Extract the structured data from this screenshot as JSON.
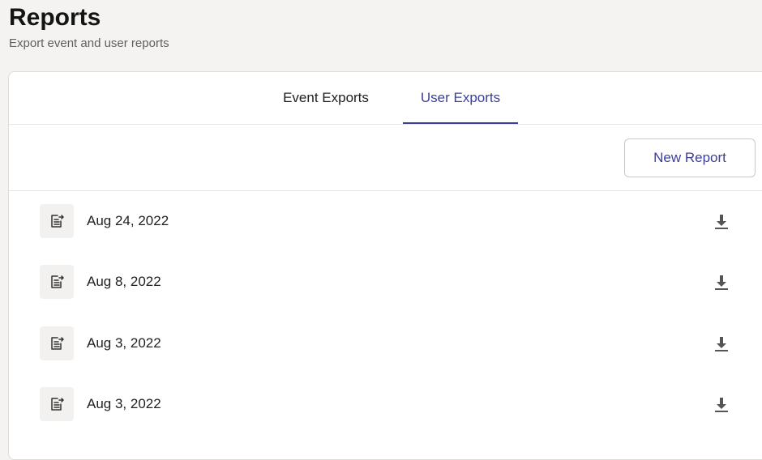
{
  "header": {
    "title": "Reports",
    "subtitle": "Export event and user reports"
  },
  "tabs": [
    {
      "label": "Event Exports",
      "active": false
    },
    {
      "label": "User Exports",
      "active": true
    }
  ],
  "toolbar": {
    "new_report_label": "New Report"
  },
  "reports": [
    {
      "date": "Aug 24, 2022",
      "icon": "file-export-icon",
      "action_icon": "download-icon"
    },
    {
      "date": "Aug 8, 2022",
      "icon": "file-export-icon",
      "action_icon": "download-icon"
    },
    {
      "date": "Aug 3, 2022",
      "icon": "file-export-icon",
      "action_icon": "download-icon"
    },
    {
      "date": "Aug 3, 2022",
      "icon": "file-export-icon",
      "action_icon": "download-icon"
    }
  ],
  "colors": {
    "accent": "#3c3f9c",
    "background": "#f4f3f1",
    "card": "#ffffff",
    "border": "#dedcd9",
    "icon_box": "#f2f1ef"
  }
}
